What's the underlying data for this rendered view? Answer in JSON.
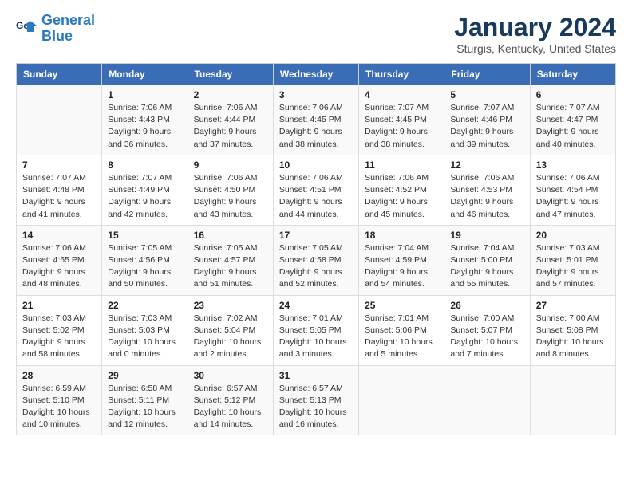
{
  "logo": {
    "line1": "General",
    "line2": "Blue"
  },
  "title": "January 2024",
  "location": "Sturgis, Kentucky, United States",
  "weekdays": [
    "Sunday",
    "Monday",
    "Tuesday",
    "Wednesday",
    "Thursday",
    "Friday",
    "Saturday"
  ],
  "weeks": [
    [
      {
        "num": "",
        "info": ""
      },
      {
        "num": "1",
        "info": "Sunrise: 7:06 AM\nSunset: 4:43 PM\nDaylight: 9 hours\nand 36 minutes."
      },
      {
        "num": "2",
        "info": "Sunrise: 7:06 AM\nSunset: 4:44 PM\nDaylight: 9 hours\nand 37 minutes."
      },
      {
        "num": "3",
        "info": "Sunrise: 7:06 AM\nSunset: 4:45 PM\nDaylight: 9 hours\nand 38 minutes."
      },
      {
        "num": "4",
        "info": "Sunrise: 7:07 AM\nSunset: 4:45 PM\nDaylight: 9 hours\nand 38 minutes."
      },
      {
        "num": "5",
        "info": "Sunrise: 7:07 AM\nSunset: 4:46 PM\nDaylight: 9 hours\nand 39 minutes."
      },
      {
        "num": "6",
        "info": "Sunrise: 7:07 AM\nSunset: 4:47 PM\nDaylight: 9 hours\nand 40 minutes."
      }
    ],
    [
      {
        "num": "7",
        "info": "Sunrise: 7:07 AM\nSunset: 4:48 PM\nDaylight: 9 hours\nand 41 minutes."
      },
      {
        "num": "8",
        "info": "Sunrise: 7:07 AM\nSunset: 4:49 PM\nDaylight: 9 hours\nand 42 minutes."
      },
      {
        "num": "9",
        "info": "Sunrise: 7:06 AM\nSunset: 4:50 PM\nDaylight: 9 hours\nand 43 minutes."
      },
      {
        "num": "10",
        "info": "Sunrise: 7:06 AM\nSunset: 4:51 PM\nDaylight: 9 hours\nand 44 minutes."
      },
      {
        "num": "11",
        "info": "Sunrise: 7:06 AM\nSunset: 4:52 PM\nDaylight: 9 hours\nand 45 minutes."
      },
      {
        "num": "12",
        "info": "Sunrise: 7:06 AM\nSunset: 4:53 PM\nDaylight: 9 hours\nand 46 minutes."
      },
      {
        "num": "13",
        "info": "Sunrise: 7:06 AM\nSunset: 4:54 PM\nDaylight: 9 hours\nand 47 minutes."
      }
    ],
    [
      {
        "num": "14",
        "info": "Sunrise: 7:06 AM\nSunset: 4:55 PM\nDaylight: 9 hours\nand 48 minutes."
      },
      {
        "num": "15",
        "info": "Sunrise: 7:05 AM\nSunset: 4:56 PM\nDaylight: 9 hours\nand 50 minutes."
      },
      {
        "num": "16",
        "info": "Sunrise: 7:05 AM\nSunset: 4:57 PM\nDaylight: 9 hours\nand 51 minutes."
      },
      {
        "num": "17",
        "info": "Sunrise: 7:05 AM\nSunset: 4:58 PM\nDaylight: 9 hours\nand 52 minutes."
      },
      {
        "num": "18",
        "info": "Sunrise: 7:04 AM\nSunset: 4:59 PM\nDaylight: 9 hours\nand 54 minutes."
      },
      {
        "num": "19",
        "info": "Sunrise: 7:04 AM\nSunset: 5:00 PM\nDaylight: 9 hours\nand 55 minutes."
      },
      {
        "num": "20",
        "info": "Sunrise: 7:03 AM\nSunset: 5:01 PM\nDaylight: 9 hours\nand 57 minutes."
      }
    ],
    [
      {
        "num": "21",
        "info": "Sunrise: 7:03 AM\nSunset: 5:02 PM\nDaylight: 9 hours\nand 58 minutes."
      },
      {
        "num": "22",
        "info": "Sunrise: 7:03 AM\nSunset: 5:03 PM\nDaylight: 10 hours\nand 0 minutes."
      },
      {
        "num": "23",
        "info": "Sunrise: 7:02 AM\nSunset: 5:04 PM\nDaylight: 10 hours\nand 2 minutes."
      },
      {
        "num": "24",
        "info": "Sunrise: 7:01 AM\nSunset: 5:05 PM\nDaylight: 10 hours\nand 3 minutes."
      },
      {
        "num": "25",
        "info": "Sunrise: 7:01 AM\nSunset: 5:06 PM\nDaylight: 10 hours\nand 5 minutes."
      },
      {
        "num": "26",
        "info": "Sunrise: 7:00 AM\nSunset: 5:07 PM\nDaylight: 10 hours\nand 7 minutes."
      },
      {
        "num": "27",
        "info": "Sunrise: 7:00 AM\nSunset: 5:08 PM\nDaylight: 10 hours\nand 8 minutes."
      }
    ],
    [
      {
        "num": "28",
        "info": "Sunrise: 6:59 AM\nSunset: 5:10 PM\nDaylight: 10 hours\nand 10 minutes."
      },
      {
        "num": "29",
        "info": "Sunrise: 6:58 AM\nSunset: 5:11 PM\nDaylight: 10 hours\nand 12 minutes."
      },
      {
        "num": "30",
        "info": "Sunrise: 6:57 AM\nSunset: 5:12 PM\nDaylight: 10 hours\nand 14 minutes."
      },
      {
        "num": "31",
        "info": "Sunrise: 6:57 AM\nSunset: 5:13 PM\nDaylight: 10 hours\nand 16 minutes."
      },
      {
        "num": "",
        "info": ""
      },
      {
        "num": "",
        "info": ""
      },
      {
        "num": "",
        "info": ""
      }
    ]
  ]
}
